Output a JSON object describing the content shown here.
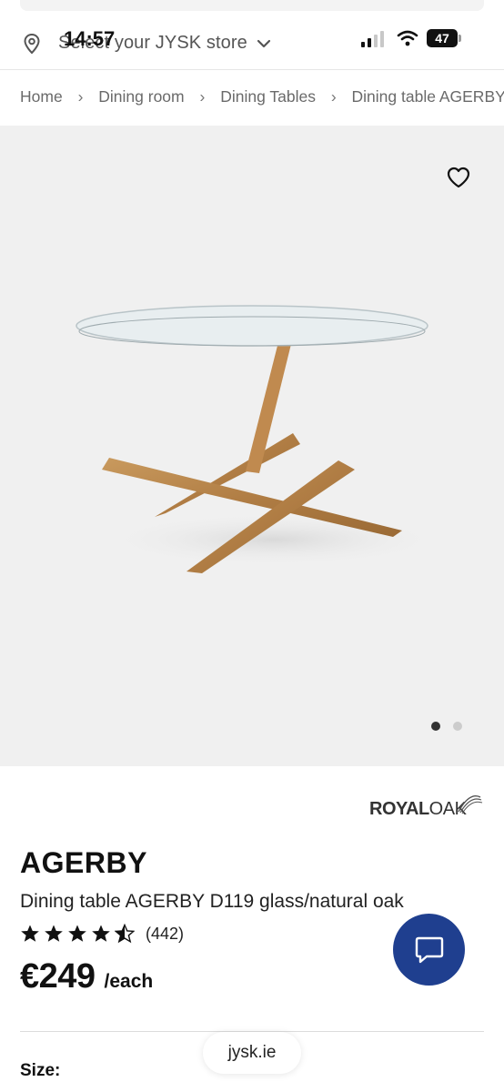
{
  "status_bar": {
    "time": "14:57",
    "battery": "47"
  },
  "store_bar": {
    "label": "Select your JYSK store",
    "icon": "location-pin-icon"
  },
  "breadcrumb": [
    "Home",
    "Dining room",
    "Dining Tables",
    "Dining table AGERBY"
  ],
  "gallery": {
    "image_count": 2,
    "active_index": 0,
    "active_dot_color": "#333333",
    "inactive_dot_color": "#cccccc"
  },
  "brand": {
    "part1": "ROYAL",
    "part2": "OAK"
  },
  "product": {
    "name": "AGERBY",
    "description": "Dining table AGERBY D119 glass/natural oak",
    "rating": 4.5,
    "review_count": "(442)",
    "price": "€249",
    "unit": "/each"
  },
  "size_label": "Size:",
  "url_pill": "jysk.ie",
  "colors": {
    "chat_button": "#1f3f8f",
    "hero_background": "#f0f0f0",
    "breadcrumb_text": "#6a6a6a"
  }
}
